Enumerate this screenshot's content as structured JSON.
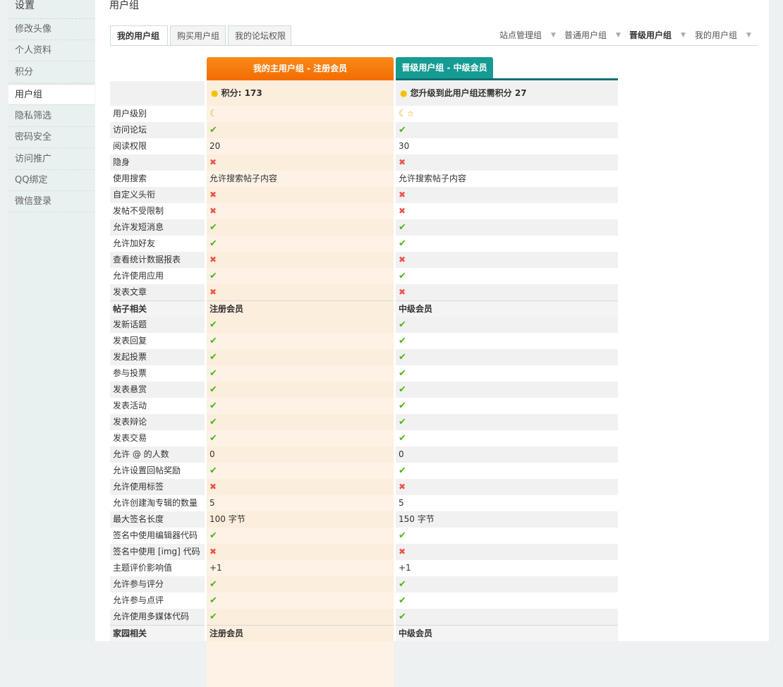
{
  "sidebar": {
    "title": "设置",
    "items": [
      {
        "label": "修改头像",
        "active": false
      },
      {
        "label": "个人资料",
        "active": false
      },
      {
        "label": "积分",
        "active": false
      },
      {
        "label": "用户组",
        "active": true
      },
      {
        "label": "隐私筛选",
        "active": false
      },
      {
        "label": "密码安全",
        "active": false
      },
      {
        "label": "访问推广",
        "active": false
      },
      {
        "label": "QQ绑定",
        "active": false
      },
      {
        "label": "微信登录",
        "active": false
      }
    ]
  },
  "page": {
    "title": "用户组",
    "tabs": [
      "我的用户组",
      "购买用户组",
      "我的论坛权限"
    ],
    "active_tab": "我的用户组",
    "right_nav": [
      "站点管理组",
      "普通用户组",
      "晋级用户组",
      "我的用户组"
    ]
  },
  "compare": {
    "col1_header": "我的主用户组 - 注册会员",
    "col2_header": "晋级用户组 - 中级会员",
    "points_col1": "积分: 173",
    "points_col2": "您升级到此用户组还需积分 27",
    "rows": [
      {
        "label": "用户级别",
        "v1": "moon",
        "v2": "moonstar"
      },
      {
        "label": "访问论坛",
        "v1": "ok",
        "v2": "ok"
      },
      {
        "label": "阅读权限",
        "v1": "20",
        "v2": "30"
      },
      {
        "label": "隐身",
        "v1": "no",
        "v2": "no"
      },
      {
        "label": "使用搜索",
        "v1": "允许搜索帖子内容",
        "v2": "允许搜索帖子内容"
      },
      {
        "label": "自定义头衔",
        "v1": "no",
        "v2": "no"
      },
      {
        "label": "发帖不受限制",
        "v1": "no",
        "v2": "no"
      },
      {
        "label": "允许发短消息",
        "v1": "ok",
        "v2": "ok"
      },
      {
        "label": "允许加好友",
        "v1": "ok",
        "v2": "ok"
      },
      {
        "label": "查看统计数据报表",
        "v1": "no",
        "v2": "no"
      },
      {
        "label": "允许使用应用",
        "v1": "ok",
        "v2": "ok"
      },
      {
        "label": "发表文章",
        "v1": "no",
        "v2": "no"
      },
      {
        "label": "帖子相关",
        "v1": "注册会员",
        "v2": "中级会员",
        "section": true
      },
      {
        "label": "发新话题",
        "v1": "ok",
        "v2": "ok"
      },
      {
        "label": "发表回复",
        "v1": "ok",
        "v2": "ok"
      },
      {
        "label": "发起投票",
        "v1": "ok",
        "v2": "ok"
      },
      {
        "label": "参与投票",
        "v1": "ok",
        "v2": "ok"
      },
      {
        "label": "发表悬赏",
        "v1": "ok",
        "v2": "ok"
      },
      {
        "label": "发表活动",
        "v1": "ok",
        "v2": "ok"
      },
      {
        "label": "发表辩论",
        "v1": "ok",
        "v2": "ok"
      },
      {
        "label": "发表交易",
        "v1": "ok",
        "v2": "ok"
      },
      {
        "label": "允许 @ 的人数",
        "v1": "0",
        "v2": "0"
      },
      {
        "label": "允许设置回帖奖励",
        "v1": "ok",
        "v2": "ok"
      },
      {
        "label": "允许使用标签",
        "v1": "no",
        "v2": "no"
      },
      {
        "label": "允许创建淘专辑的数量",
        "v1": "5",
        "v2": "5"
      },
      {
        "label": "最大签名长度",
        "v1": "100 字节",
        "v2": "150 字节"
      },
      {
        "label": "签名中使用编辑器代码",
        "v1": "ok",
        "v2": "ok"
      },
      {
        "label": "签名中使用 [img] 代码",
        "v1": "no",
        "v2": "no"
      },
      {
        "label": "主题评价影响值",
        "v1": "+1",
        "v2": "+1"
      },
      {
        "label": "允许参与评分",
        "v1": "ok",
        "v2": "ok"
      },
      {
        "label": "允许参与点评",
        "v1": "ok",
        "v2": "ok"
      },
      {
        "label": "允许使用多媒体代码",
        "v1": "ok",
        "v2": "ok"
      },
      {
        "label": "家园相关",
        "v1": "注册会员",
        "v2": "中级会员",
        "section": true
      }
    ]
  },
  "icons": {
    "ok": "check-icon",
    "no": "cross-icon",
    "moon": "moon-icon",
    "star": "star-icon",
    "bulb": "lightbulb-icon"
  },
  "colors": {
    "accent_orange": "#f36c00",
    "accent_teal": "#169b93",
    "ok_green": "#4eb41a",
    "no_red": "#e8554a"
  }
}
